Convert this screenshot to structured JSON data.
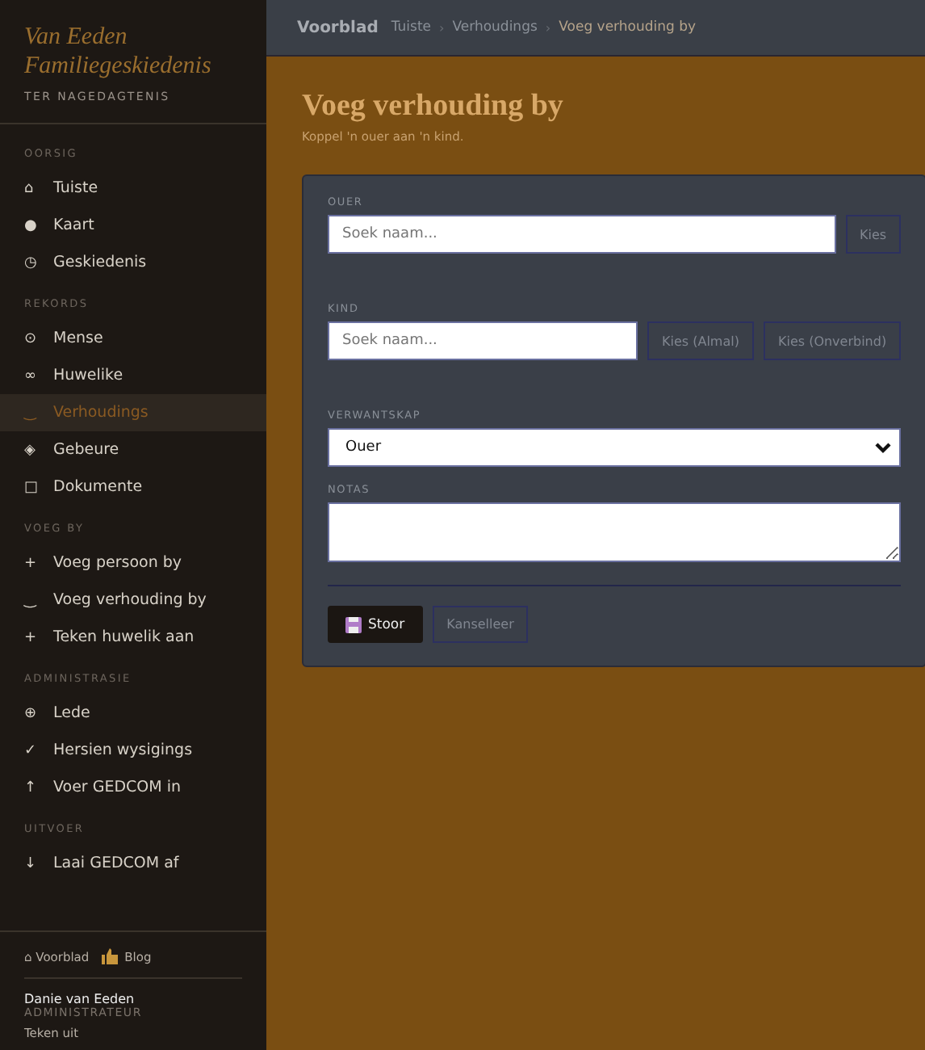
{
  "brand": {
    "title": "Van Eeden Familiegeskiedenis",
    "subtitle": "TER NAGEDAGTENIS"
  },
  "sidebar": {
    "sections": [
      {
        "heading": "OORSIG",
        "items": [
          {
            "icon": "⌂",
            "label": "Tuiste",
            "selected": false
          },
          {
            "icon": "●",
            "label": "Kaart",
            "selected": false
          },
          {
            "icon": "◷",
            "label": "Geskiedenis",
            "selected": false
          }
        ]
      },
      {
        "heading": "REKORDS",
        "items": [
          {
            "icon": "⊙",
            "label": "Mense",
            "selected": false
          },
          {
            "icon": "∞",
            "label": "Huwelike",
            "selected": false
          },
          {
            "icon": "‿",
            "label": "Verhoudings",
            "selected": true
          },
          {
            "icon": "◈",
            "label": "Gebeure",
            "selected": false
          },
          {
            "icon": "□",
            "label": "Dokumente",
            "selected": false
          }
        ]
      },
      {
        "heading": "VOEG BY",
        "items": [
          {
            "icon": "+",
            "label": "Voeg persoon by",
            "selected": false
          },
          {
            "icon": "‿",
            "label": "Voeg verhouding by",
            "selected": false
          },
          {
            "icon": "+",
            "label": "Teken huwelik aan",
            "selected": false
          }
        ]
      },
      {
        "heading": "ADMINISTRASIE",
        "items": [
          {
            "icon": "⊕",
            "label": "Lede",
            "selected": false
          },
          {
            "icon": "✓",
            "label": "Hersien wysigings",
            "selected": false
          },
          {
            "icon": "↑",
            "label": "Voer GEDCOM in",
            "selected": false
          }
        ]
      },
      {
        "heading": "UITVOER",
        "items": [
          {
            "icon": "↓",
            "label": "Laai GEDCOM af",
            "selected": false
          }
        ]
      }
    ]
  },
  "footer": {
    "home_link": "⌂ Voorblad",
    "blog_link": "Blog",
    "user_name": "Danie van Eeden",
    "user_role": "ADMINISTRATEUR",
    "sign_out": "Teken uit"
  },
  "breadcrumb": {
    "brand": "Voorblad",
    "items": [
      "Tuiste",
      "Verhoudings",
      "Voeg verhouding by"
    ],
    "separator": "›"
  },
  "page": {
    "title": "Voeg verhouding by",
    "subtitle": "Koppel 'n ouer aan 'n kind."
  },
  "form": {
    "parent": {
      "label": "OUER",
      "placeholder": "Soek naam...",
      "buttons": [
        "Kies"
      ]
    },
    "child": {
      "label": "KIND",
      "placeholder": "Soek naam...",
      "buttons": [
        "Kies (Almal)",
        "Kies (Onverbind)"
      ]
    },
    "relationship": {
      "label": "VERWANTSKAP",
      "value": "Ouer"
    },
    "notes": {
      "label": "NOTAS"
    },
    "save": "Stoor",
    "cancel": "Kanselleer"
  }
}
